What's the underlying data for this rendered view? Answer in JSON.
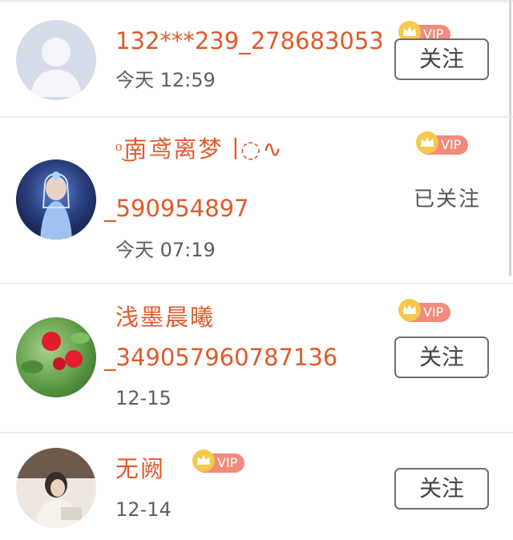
{
  "users": [
    {
      "name_line1": "132***239_278683053",
      "name_line2": "",
      "time": "今天  12:59",
      "vip_label": "VIP",
      "follow_label": "关注"
    },
    {
      "name_line1": "南鸢离梦",
      "name_line2": "_590954897",
      "time": "今天  07:19",
      "vip_label": "VIP",
      "follow_label": "已关注"
    },
    {
      "name_line1": "浅墨晨曦",
      "name_line2": "_349057960787136",
      "time": "12-15",
      "vip_label": "VIP",
      "follow_label": "关注"
    },
    {
      "name_line1": "无阙",
      "name_line2": "",
      "time": "12-14",
      "vip_label": "VIP",
      "follow_label": "关注"
    }
  ],
  "colors": {
    "name": "#e05a2c",
    "vip_badge": "#f08b7e",
    "crown": "#f2b233",
    "divider": "#ececec"
  }
}
